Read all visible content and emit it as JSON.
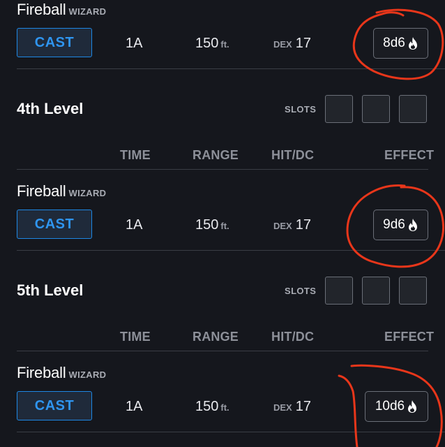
{
  "spells": [
    {
      "name": "Fireball",
      "class": "WIZARD",
      "cast_label": "CAST",
      "time": "1A",
      "range": "150",
      "range_unit": "ft.",
      "hit_label": "DEX",
      "hit_value": "17",
      "effect": "8d6"
    },
    {
      "name": "Fireball",
      "class": "WIZARD",
      "cast_label": "CAST",
      "time": "1A",
      "range": "150",
      "range_unit": "ft.",
      "hit_label": "DEX",
      "hit_value": "17",
      "effect": "9d6"
    },
    {
      "name": "Fireball",
      "class": "WIZARD",
      "cast_label": "CAST",
      "time": "1A",
      "range": "150",
      "range_unit": "ft.",
      "hit_label": "DEX",
      "hit_value": "17",
      "effect": "10d6"
    }
  ],
  "levels": [
    {
      "title": "4th Level",
      "slots_label": "SLOTS"
    },
    {
      "title": "5th Level",
      "slots_label": "SLOTS"
    }
  ],
  "columns": {
    "time": "TIME",
    "range": "RANGE",
    "hit": "HIT/DC",
    "effect": "EFFECT"
  },
  "icons": {
    "effect_icon": "fire-icon"
  },
  "colors": {
    "accent": "#1e88e5",
    "background": "#15171d",
    "annotation": "#e8361a",
    "fire": "#ffffff"
  }
}
